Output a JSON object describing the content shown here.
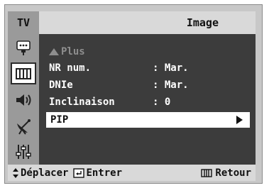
{
  "header": {
    "tab": "TV",
    "title": "Image"
  },
  "sidebar": {
    "items": [
      {
        "icon": "picture-icon",
        "active": false
      },
      {
        "icon": "image-adjust-icon",
        "active": true
      },
      {
        "icon": "speaker-icon",
        "active": false
      },
      {
        "icon": "satellite-icon",
        "active": false
      },
      {
        "icon": "sliders-icon",
        "active": false
      }
    ]
  },
  "menu": {
    "more_label": "Plus",
    "items": [
      {
        "label": "NR num.",
        "value": ": Mar."
      },
      {
        "label": "DNIe",
        "value": ": Mar."
      },
      {
        "label": "Inclinaison",
        "value": ": 0"
      },
      {
        "label": "PIP",
        "value": ""
      }
    ]
  },
  "footer": {
    "move": "Déplacer",
    "enter": "Entrer",
    "back": "Retour"
  },
  "colors": {
    "content_bg": "#3c3c3c",
    "sidebar_bg": "#9a9a9a",
    "title_bg": "#d9d9d9",
    "selected_bg": "#ffffff"
  }
}
